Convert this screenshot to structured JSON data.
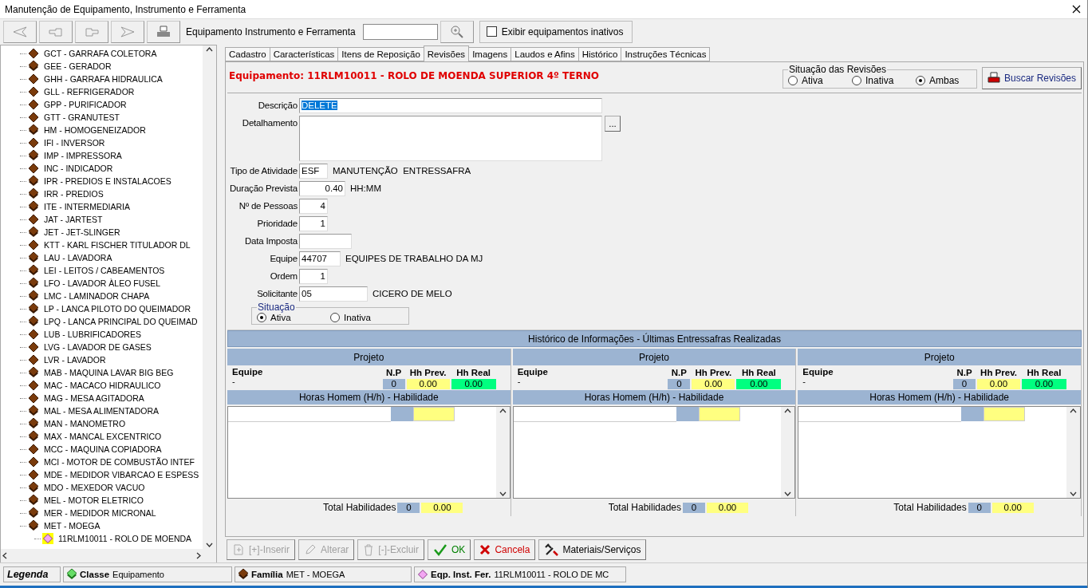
{
  "window": {
    "title": "Manutenção de Equipamento, Instrumento e Ferramenta"
  },
  "toolbar": {
    "search_label": "Equipamento Instrumento e Ferramenta",
    "show_inactive": {
      "label": "Exibir equipamentos inativos",
      "checked": false
    }
  },
  "tree": {
    "items": [
      {
        "label": "GCT - GARRAFA COLETORA",
        "kind": "single",
        "selected": false
      },
      {
        "label": "GEE - GERADOR",
        "kind": "stack",
        "selected": false
      },
      {
        "label": "GHH - GARRAFA HIDRAULICA",
        "kind": "single",
        "selected": false
      },
      {
        "label": "GLL - REFRIGERADOR",
        "kind": "single",
        "selected": false
      },
      {
        "label": "GPP - PURIFICADOR",
        "kind": "single",
        "selected": false
      },
      {
        "label": "GTT - GRANUTEST",
        "kind": "single",
        "selected": false
      },
      {
        "label": "HM - HOMOGENEIZADOR",
        "kind": "stack",
        "selected": false
      },
      {
        "label": "IFI - INVERSOR",
        "kind": "single",
        "selected": false
      },
      {
        "label": "IMP - IMPRESSORA",
        "kind": "stack",
        "selected": false
      },
      {
        "label": "INC - INDICADOR",
        "kind": "single",
        "selected": false
      },
      {
        "label": "IPR - PREDIOS E INSTALACOES",
        "kind": "stack",
        "selected": false
      },
      {
        "label": "IRR - PREDIOS",
        "kind": "stack",
        "selected": false
      },
      {
        "label": "ITE - INTERMEDIARIA",
        "kind": "stack",
        "selected": false
      },
      {
        "label": "JAT - JARTEST",
        "kind": "single",
        "selected": false
      },
      {
        "label": "JET - JET-SLINGER",
        "kind": "stack",
        "selected": false
      },
      {
        "label": "KTT - KARL FISCHER TITULADOR DL",
        "kind": "single",
        "selected": false
      },
      {
        "label": "LAU - LAVADORA",
        "kind": "stack",
        "selected": false
      },
      {
        "label": "LEI - LEITOS / CABEAMENTOS",
        "kind": "stack",
        "selected": false
      },
      {
        "label": "LFO - LAVADOR ÀLEO FUSEL",
        "kind": "stack",
        "selected": false
      },
      {
        "label": "LMC - LAMINADOR CHAPA",
        "kind": "stack",
        "selected": false
      },
      {
        "label": "LP - LANCA PILOTO DO QUEIMADOR",
        "kind": "stack",
        "selected": false
      },
      {
        "label": "LPQ - LANCA PRINCIPAL DO QUEIMAD",
        "kind": "stack",
        "selected": false
      },
      {
        "label": "LUB - LUBRIFICADORES",
        "kind": "single",
        "selected": false
      },
      {
        "label": "LVG - LAVADOR DE GASES",
        "kind": "single",
        "selected": false
      },
      {
        "label": "LVR - LAVADOR",
        "kind": "single",
        "selected": false
      },
      {
        "label": "MAB - MAQUINA LAVAR BIG BEG",
        "kind": "stack",
        "selected": false
      },
      {
        "label": "MAC - MACACO HIDRAULICO",
        "kind": "single",
        "selected": false
      },
      {
        "label": "MAG - MESA AGITADORA",
        "kind": "single",
        "selected": false
      },
      {
        "label": "MAL - MESA ALIMENTADORA",
        "kind": "stack",
        "selected": false
      },
      {
        "label": "MAN - MANOMETRO",
        "kind": "stack",
        "selected": false
      },
      {
        "label": "MAX - MANCAL EXCENTRICO",
        "kind": "stack",
        "selected": false
      },
      {
        "label": "MCC - MAQUINA COPIADORA",
        "kind": "single",
        "selected": false
      },
      {
        "label": "MCI - MOTOR DE COMBUSTÃO INTEF",
        "kind": "single",
        "selected": false
      },
      {
        "label": "MDE - MEDIDOR VIBARCAO E ESPESS",
        "kind": "single",
        "selected": false
      },
      {
        "label": "MDO - MEXEDOR VACUO",
        "kind": "stack",
        "selected": false
      },
      {
        "label": "MEL - MOTOR ELETRICO",
        "kind": "stack",
        "selected": false
      },
      {
        "label": "MER - MEDIDOR MICRONAL",
        "kind": "stack",
        "selected": false
      },
      {
        "label": "MET - MOEGA",
        "kind": "stack",
        "selected": false,
        "children": [
          {
            "label": "11RLM10011 - ROLO DE MOENDA",
            "kind": "item",
            "selected": true
          }
        ]
      }
    ]
  },
  "tabs": [
    {
      "label": "Cadastro",
      "selected": false
    },
    {
      "label": "Características",
      "selected": false
    },
    {
      "label": "Itens de Reposição",
      "selected": false
    },
    {
      "label": "Revisões",
      "selected": true
    },
    {
      "label": "Imagens",
      "selected": false
    },
    {
      "label": "Laudos e Afins",
      "selected": false
    },
    {
      "label": "Histórico",
      "selected": false
    },
    {
      "label": "Instruções Técnicas",
      "selected": false
    }
  ],
  "equipment_heading": "Equipamento: 11RLM10011 - ROLO DE MOENDA SUPERIOR 4º TERNO",
  "revision_status": {
    "title": "Situação das Revisões",
    "options": [
      {
        "label": "Ativa",
        "selected": false
      },
      {
        "label": "Inativa",
        "selected": false
      },
      {
        "label": "Ambas",
        "selected": true
      }
    ]
  },
  "search_button": "Buscar Revisões",
  "form": {
    "fields": [
      {
        "label": "Descrição",
        "kind": "text",
        "value": "DELETE",
        "highlighted": true
      },
      {
        "label": "Detalhamento",
        "kind": "textarea",
        "more_button": "..."
      },
      {
        "label": "Tipo de Atividade",
        "kind": "text",
        "value": "ESF",
        "note": "MANUTENÇÃO  ENTRESSAFRA"
      },
      {
        "label": "Duração Prevista",
        "kind": "number",
        "value": "0.40",
        "note": "HH:MM"
      },
      {
        "label": "Nº de Pessoas",
        "kind": "number",
        "value": "4"
      },
      {
        "label": "Prioridade",
        "kind": "number",
        "value": "1"
      },
      {
        "label": "Data Imposta",
        "kind": "text"
      },
      {
        "label": "Equipe",
        "kind": "text",
        "value": "44707",
        "note": "EQUIPES DE TRABALHO DA MJ"
      },
      {
        "label": "Ordem",
        "kind": "number",
        "value": "1"
      },
      {
        "label": "Solicitante",
        "kind": "text",
        "value": "05",
        "note": "CICERO DE MELO"
      }
    ]
  },
  "situacao": {
    "title": "Situação",
    "options": [
      {
        "label": "Ativa",
        "selected": true
      },
      {
        "label": "Inativa",
        "selected": false
      }
    ]
  },
  "history": {
    "title": "Histórico de Informações - Últimas Entressafras Realizadas",
    "columns": [
      {
        "project": "Projeto",
        "team_label": "Equipe",
        "team": "-",
        "np_label": "N.P",
        "np": "0",
        "hh_prev_label": "Hh Prev.",
        "hh_prev": "0.00",
        "hh_real_label": "Hh Real",
        "hh_real": "0.00",
        "skills_header": "Horas Homem (H/h) - Habilidade",
        "total_label": "Total Habilidades",
        "total_np": "0",
        "total_hh": "0.00"
      },
      {
        "project": "Projeto",
        "team_label": "Equipe",
        "team": "-",
        "np_label": "N.P",
        "np": "0",
        "hh_prev_label": "Hh Prev.",
        "hh_prev": "0.00",
        "hh_real_label": "Hh Real",
        "hh_real": "0.00",
        "skills_header": "Horas Homem (H/h) - Habilidade",
        "total_label": "Total Habilidades",
        "total_np": "0",
        "total_hh": "0.00"
      },
      {
        "project": "Projeto",
        "team_label": "Equipe",
        "team": "-",
        "np_label": "N.P",
        "np": "0",
        "hh_prev_label": "Hh Prev.",
        "hh_prev": "0.00",
        "hh_real_label": "Hh Real",
        "hh_real": "0.00",
        "skills_header": "Horas Homem (H/h) - Habilidade",
        "total_label": "Total Habilidades",
        "total_np": "0",
        "total_hh": "0.00"
      }
    ]
  },
  "actions": [
    {
      "label": "[+]-Inserir",
      "kind": "insert",
      "disabled": true
    },
    {
      "label": "Alterar",
      "kind": "edit",
      "disabled": true
    },
    {
      "label": "[-]-Excluir",
      "kind": "delete",
      "disabled": true
    },
    {
      "label": "OK",
      "kind": "ok",
      "disabled": false
    },
    {
      "label": "Cancela",
      "kind": "cancel",
      "disabled": false
    },
    {
      "label": "Materiais/Serviços",
      "kind": "materials",
      "disabled": false
    }
  ],
  "status_bar": {
    "legend": "Legenda",
    "items": [
      {
        "label": "Classe",
        "value": "Equipamento",
        "kind": "class"
      },
      {
        "label": "Família",
        "value": "MET - MOEGA",
        "kind": "family"
      },
      {
        "label": "Eqp. Inst. Fer.",
        "value": "11RLM10011 - ROLO DE MC",
        "kind": "item"
      }
    ]
  }
}
